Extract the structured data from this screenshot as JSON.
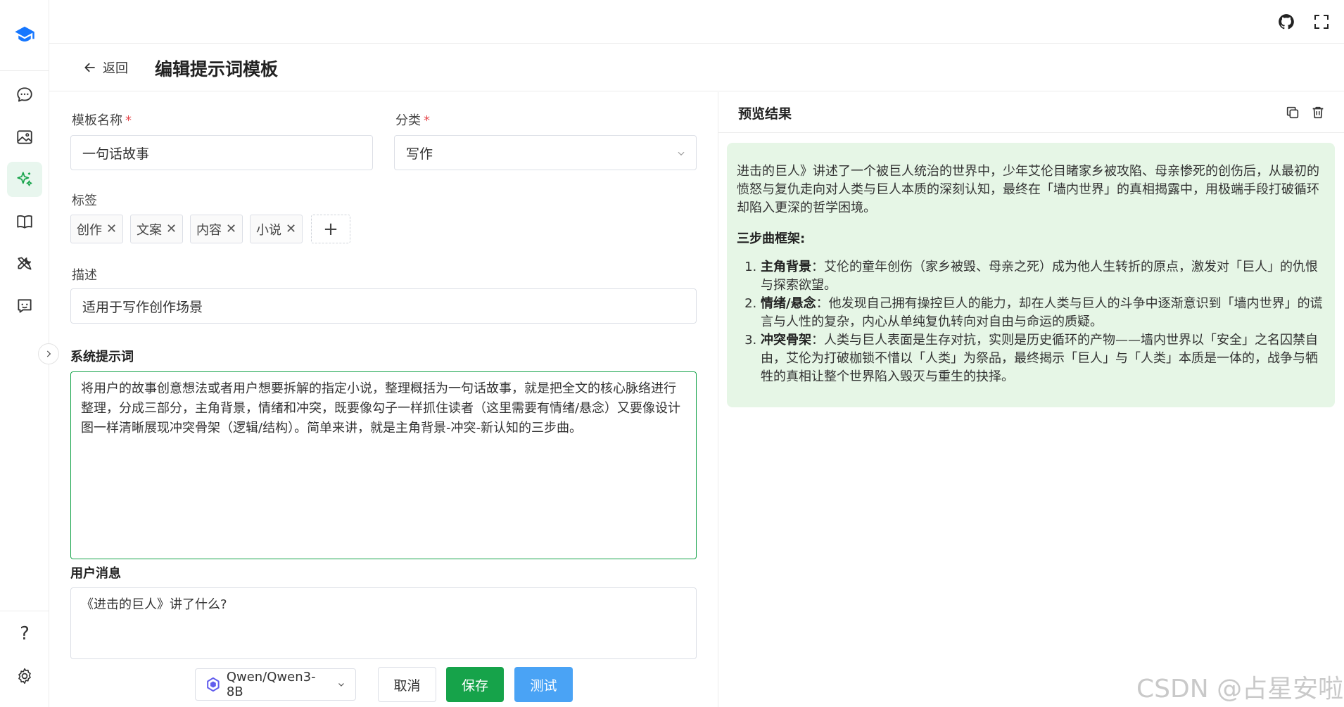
{
  "sidebar": {
    "items": [
      {
        "name": "chat",
        "icon": "chat-bubble-icon"
      },
      {
        "name": "image",
        "icon": "image-icon"
      },
      {
        "name": "prompt",
        "icon": "sparkles-icon",
        "active": true
      },
      {
        "name": "knowledge",
        "icon": "book-icon"
      },
      {
        "name": "tools",
        "icon": "tools-icon"
      },
      {
        "name": "assistant",
        "icon": "bot-face-icon"
      }
    ],
    "help": "?"
  },
  "header": {
    "back_label": "返回",
    "title": "编辑提示词模板"
  },
  "form": {
    "name_label": "模板名称",
    "name_value": "一句话故事",
    "category_label": "分类",
    "category_value": "写作",
    "required_mark": "*",
    "tags_label": "标签",
    "tags": [
      "创作",
      "文案",
      "内容",
      "小说"
    ],
    "tag_remove": "✕",
    "tag_add": "+",
    "desc_label": "描述",
    "desc_value": "适用于写作创作场景",
    "system_label": "系统提示词",
    "system_value": "将用户的故事创意想法或者用户想要拆解的指定小说，整理概括为一句话故事，就是把全文的核心脉络进行整理，分成三部分，主角背景，情绪和冲突，既要像勾子一样抓住读者（这里需要有情绪/悬念）又要像设计图一样清晰展现冲突骨架（逻辑/结构）。简单来讲，就是主角背景-冲突-新认知的三步曲。",
    "user_label": "用户消息",
    "user_value": "《进击的巨人》讲了什么?"
  },
  "actions": {
    "model": "Qwen/Qwen3-8B",
    "cancel": "取消",
    "save": "保存",
    "test": "测试"
  },
  "preview": {
    "title": "预览结果",
    "intro": "进击的巨人》讲述了一个被巨人统治的世界中，少年艾伦目睹家乡被攻陷、母亲惨死的创伤后，从最初的愤怒与复仇走向对人类与巨人本质的深刻认知，最终在「墙内世界」的真相揭露中，用极端手段打破循环却陷入更深的哲学困境。",
    "framework_heading": "三步曲框架",
    "framework_colon": ":",
    "steps": [
      {
        "term": "主角背景",
        "text": "：艾伦的童年创伤（家乡被毁、母亲之死）成为他人生转折的原点，激发对「巨人」的仇恨与探索欲望。"
      },
      {
        "term": "情绪/悬念",
        "text": "：他发现自己拥有操控巨人的能力，却在人类与巨人的斗争中逐渐意识到「墙内世界」的谎言与人性的复杂，内心从单纯复仇转向对自由与命运的质疑。"
      },
      {
        "term": "冲突骨架",
        "text": "：人类与巨人表面是生存对抗，实则是历史循环的产物——墙内世界以「安全」之名囚禁自由，艾伦为打破枷锁不惜以「人类」为祭品，最终揭示「巨人」与「人类」本质是一体的，战争与牺牲的真相让整个世界陷入毁灭与重生的抉择。"
      }
    ]
  },
  "watermark": "CSDN @占星安啦",
  "colors": {
    "accent": "#16a34a",
    "test_button": "#4aa3f5",
    "preview_bg": "#e6f6e6",
    "required": "#e5484d"
  }
}
